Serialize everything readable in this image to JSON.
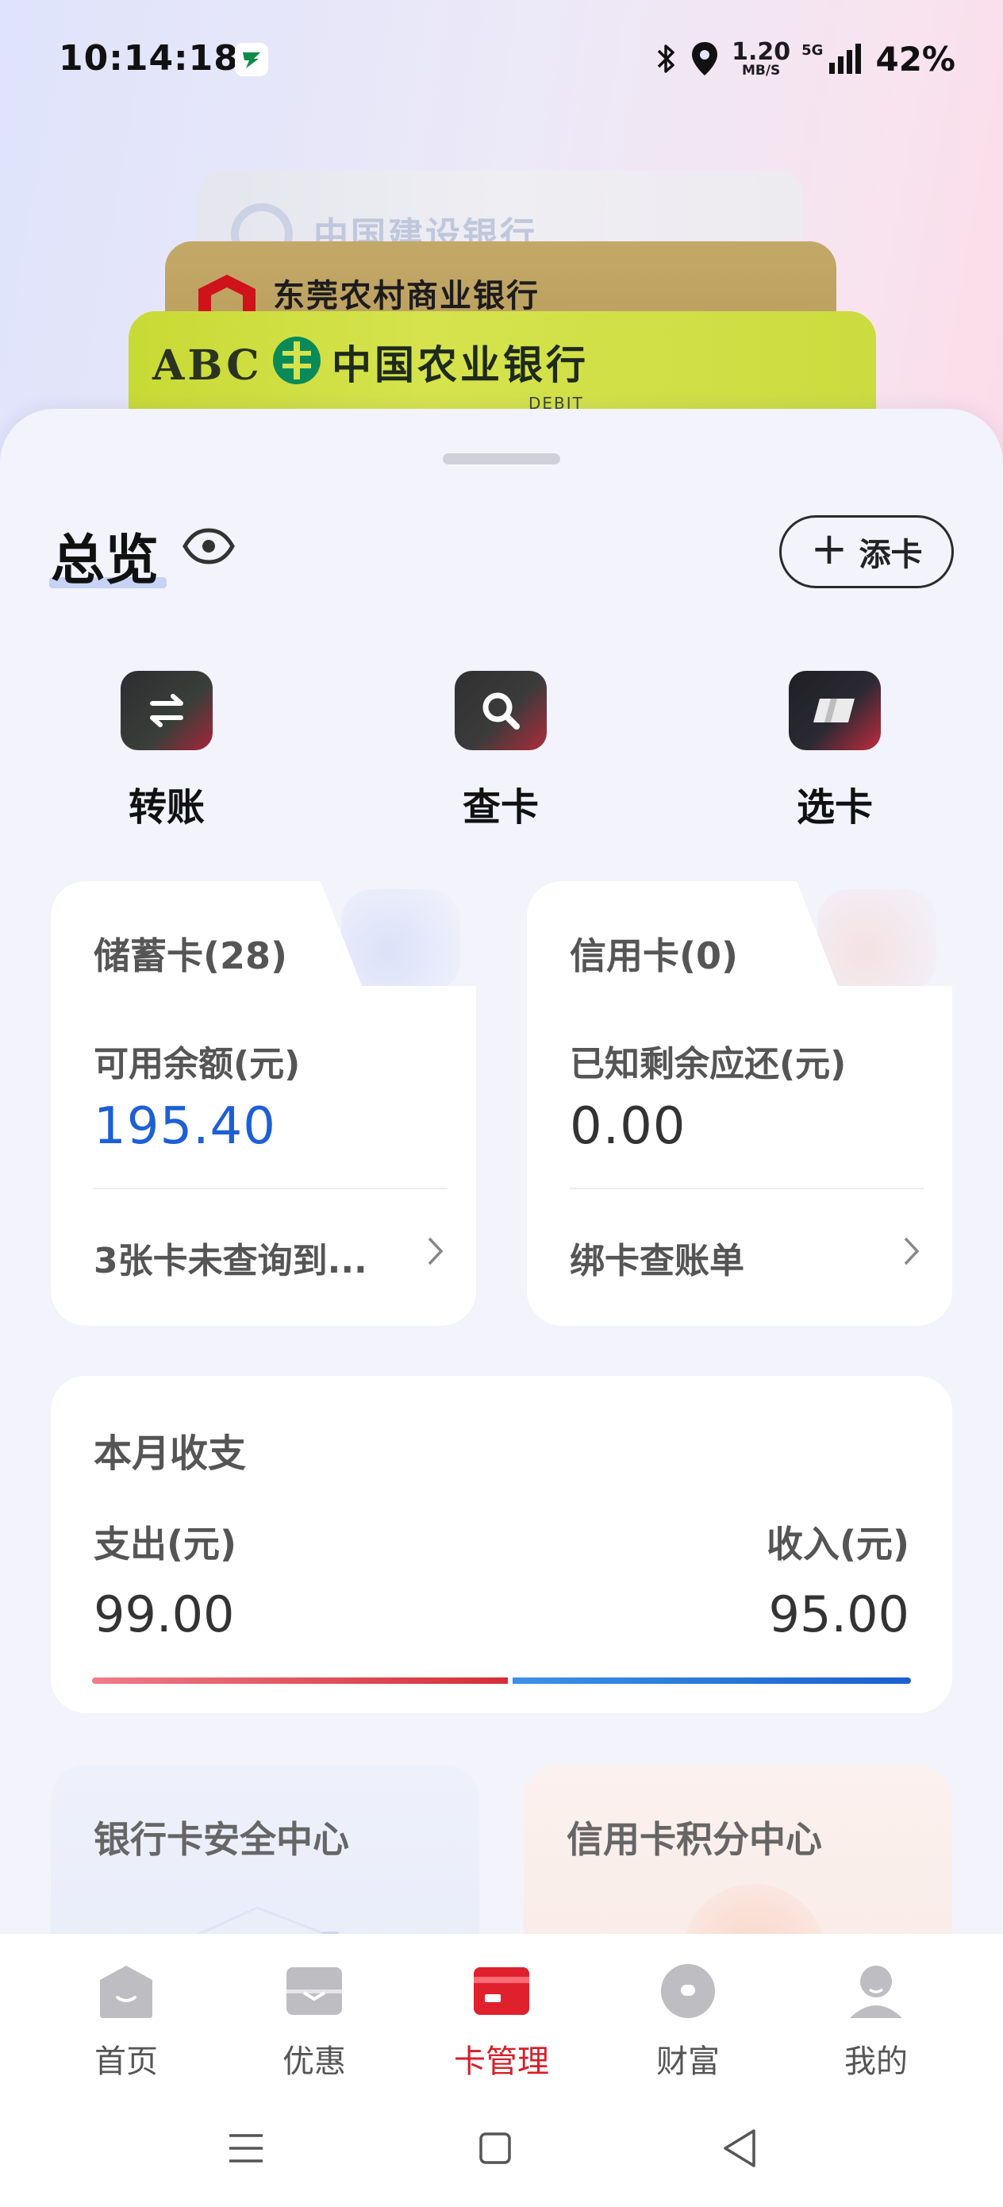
{
  "status_bar": {
    "time": "10:14:18",
    "speed_value": "1.20",
    "speed_unit": "MB/S",
    "network": "5G",
    "battery": "42%"
  },
  "bank_cards": [
    {
      "name": "中国建设银行"
    },
    {
      "name": "东莞农村商业银行"
    },
    {
      "name": "中国农业银行",
      "prefix": "ABC",
      "tag": "DEBIT"
    }
  ],
  "overview": {
    "title": "总览",
    "add_card_label": "添卡"
  },
  "actions": {
    "transfer": "转账",
    "query_card": "查卡",
    "choose_card": "选卡"
  },
  "debit": {
    "header": "储蓄卡(28)",
    "balance_label": "可用余额(元)",
    "balance": "195.40",
    "footer": "3张卡未查询到..."
  },
  "credit": {
    "header": "信用卡(0)",
    "due_label": "已知剩余应还(元)",
    "due": "0.00",
    "footer": "绑卡查账单"
  },
  "monthly": {
    "title": "本月收支",
    "expense_label": "支出(元)",
    "income_label": "收入(元)",
    "expense": "99.00",
    "income": "95.00",
    "expense_value": 99.0,
    "income_value": 95.0
  },
  "features": {
    "security_center": "银行卡安全中心",
    "points_center": "信用卡积分中心"
  },
  "tabbar": {
    "home": "首页",
    "deals": "优惠",
    "card_manage": "卡管理",
    "wealth": "财富",
    "mine": "我的",
    "active": "卡管理"
  },
  "colors": {
    "accent_red": "#d81e2a",
    "balance_blue": "#1d5fd6",
    "expense_bar": "#d42e35",
    "income_bar": "#1b5fd0"
  }
}
